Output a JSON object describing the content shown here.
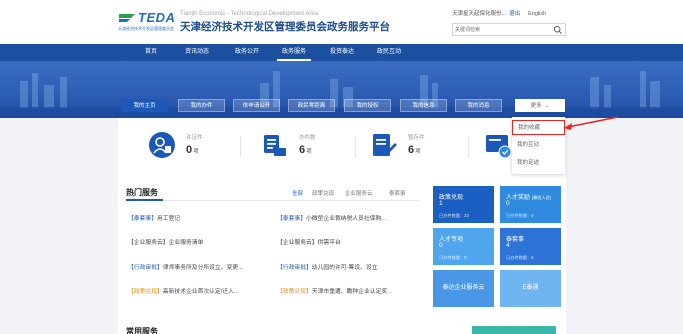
{
  "header": {
    "logo_text": "TEDA",
    "logo_sub": "天津经济技术开发区管理委员会",
    "title_en": "Tianjin Economic - Technological Development Area",
    "title_cn": "天津经济技术开发区管理委员会政务服务平台",
    "user_text": "天津星天起保化服份...",
    "logout": "退出",
    "lang": "English",
    "search_placeholder": "关键词检索"
  },
  "nav": {
    "items": [
      "首页",
      "资讯动态",
      "政务公开",
      "政务服务",
      "投资泰达",
      "政民互动"
    ],
    "active_index": 3
  },
  "tabs": {
    "items": [
      "我的主页",
      "我的办件",
      "依申请公开",
      "政民零距离",
      "我的授权",
      "我的信息",
      "我的消息"
    ],
    "more": "更多"
  },
  "stats": [
    {
      "label": "许证件",
      "value": "0",
      "unit": "项"
    },
    {
      "label": "办件数",
      "value": "6",
      "unit": "项"
    },
    {
      "label": "暂存件",
      "value": "6",
      "unit": "项"
    }
  ],
  "dropdown": {
    "items": [
      "我的收藏",
      "我的互动",
      "我的足迹"
    ],
    "highlight_index": 0
  },
  "hot": {
    "title": "热门服务",
    "filters": [
      "全部",
      "政策兑现",
      "企业服务云",
      "泰套事"
    ],
    "services": [
      {
        "tag": "【泰套事】",
        "text": "用工登记",
        "tag_color": "blue"
      },
      {
        "tag": "【泰套事】",
        "text": "小微型企业裁纳税人员社保购...",
        "tag_color": "blue"
      },
      {
        "tag": "【企业服务云】",
        "text": "企业服务清单",
        "tag_color": "none"
      },
      {
        "tag": "【企业服务云】",
        "text": "供需平台",
        "tag_color": "none"
      },
      {
        "tag": "【行政审批】",
        "text": "律师事务所及分所设立、变更...",
        "tag_color": "blue"
      },
      {
        "tag": "【行政审批】",
        "text": "幼儿园的许可-筹设、设立",
        "tag_color": "blue"
      },
      {
        "tag": "【政策兑现】",
        "text": "高新技术企业首次认定/迁入...",
        "tag_color": "orange"
      },
      {
        "tag": "【政策兑现】",
        "text": "天津市重遭、瞻种企业认定奖...",
        "tag_color": "orange"
      }
    ]
  },
  "tiles": [
    {
      "title": "政策兑现",
      "sub": "",
      "value": "1",
      "foot": "已办件数量：23",
      "color": "#1b5fc2"
    },
    {
      "title": "人才奖励",
      "sub": "(最优人员)",
      "value": "0",
      "foot": "已办件数量：0",
      "color": "#2e8be0"
    },
    {
      "title": "人才专项",
      "sub": "",
      "value": "0",
      "foot": "已办件数量：0",
      "color": "#4fa6ee"
    },
    {
      "title": "泰套事",
      "sub": "",
      "value": "4",
      "foot": "已办件数量：5",
      "color": "#2e74d6"
    },
    {
      "title": "泰达企业服务云",
      "sub": "",
      "value": "",
      "foot": "",
      "color": "#4a97e8"
    },
    {
      "title": "E泰通",
      "sub": "",
      "value": "",
      "foot": "",
      "color": "#6fb5f0"
    }
  ],
  "common": {
    "title": "常用服务"
  },
  "colors": {
    "nav": "#1b4fa0",
    "accent": "#1b58b8",
    "highlight": "#e22222"
  }
}
